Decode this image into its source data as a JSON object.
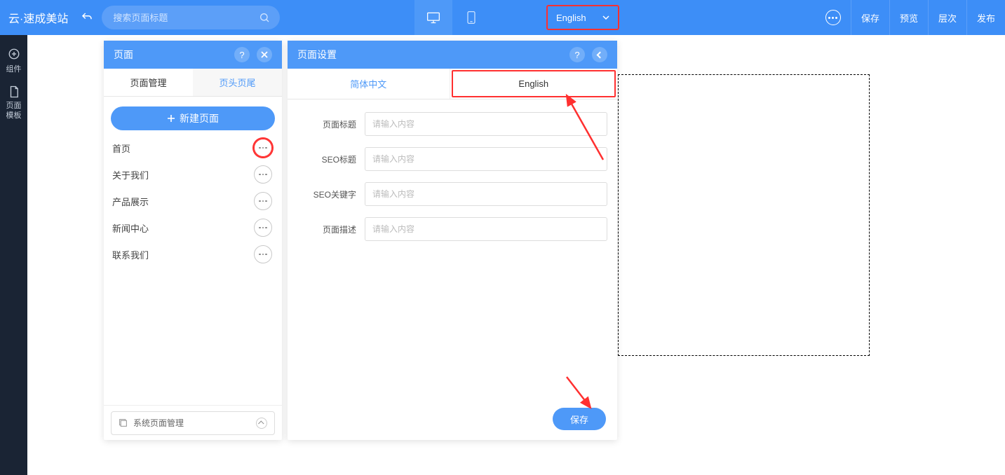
{
  "header": {
    "logo": "云·速成美站",
    "search_placeholder": "搜索页面标题",
    "language": "English",
    "actions": {
      "save": "保存",
      "preview": "预览",
      "layers": "层次",
      "publish": "发布"
    }
  },
  "left_nav": {
    "components": "组件",
    "page_template": "页面\n模板"
  },
  "pages_panel": {
    "title": "页面",
    "tabs": {
      "manage": "页面管理",
      "header_footer": "页头页尾"
    },
    "new_page": "新建页面",
    "items": [
      {
        "label": "首页"
      },
      {
        "label": "关于我们"
      },
      {
        "label": "产品展示"
      },
      {
        "label": "新闻中心"
      },
      {
        "label": "联系我们"
      }
    ],
    "system_pages": "系统页面管理"
  },
  "settings_panel": {
    "title": "页面设置",
    "tabs": {
      "zh": "简体中文",
      "en": "English"
    },
    "fields": {
      "page_title": "页面标题",
      "seo_title": "SEO标题",
      "seo_keywords": "SEO关键字",
      "page_desc": "页面描述"
    },
    "placeholder": "请输入内容",
    "save": "保存"
  }
}
